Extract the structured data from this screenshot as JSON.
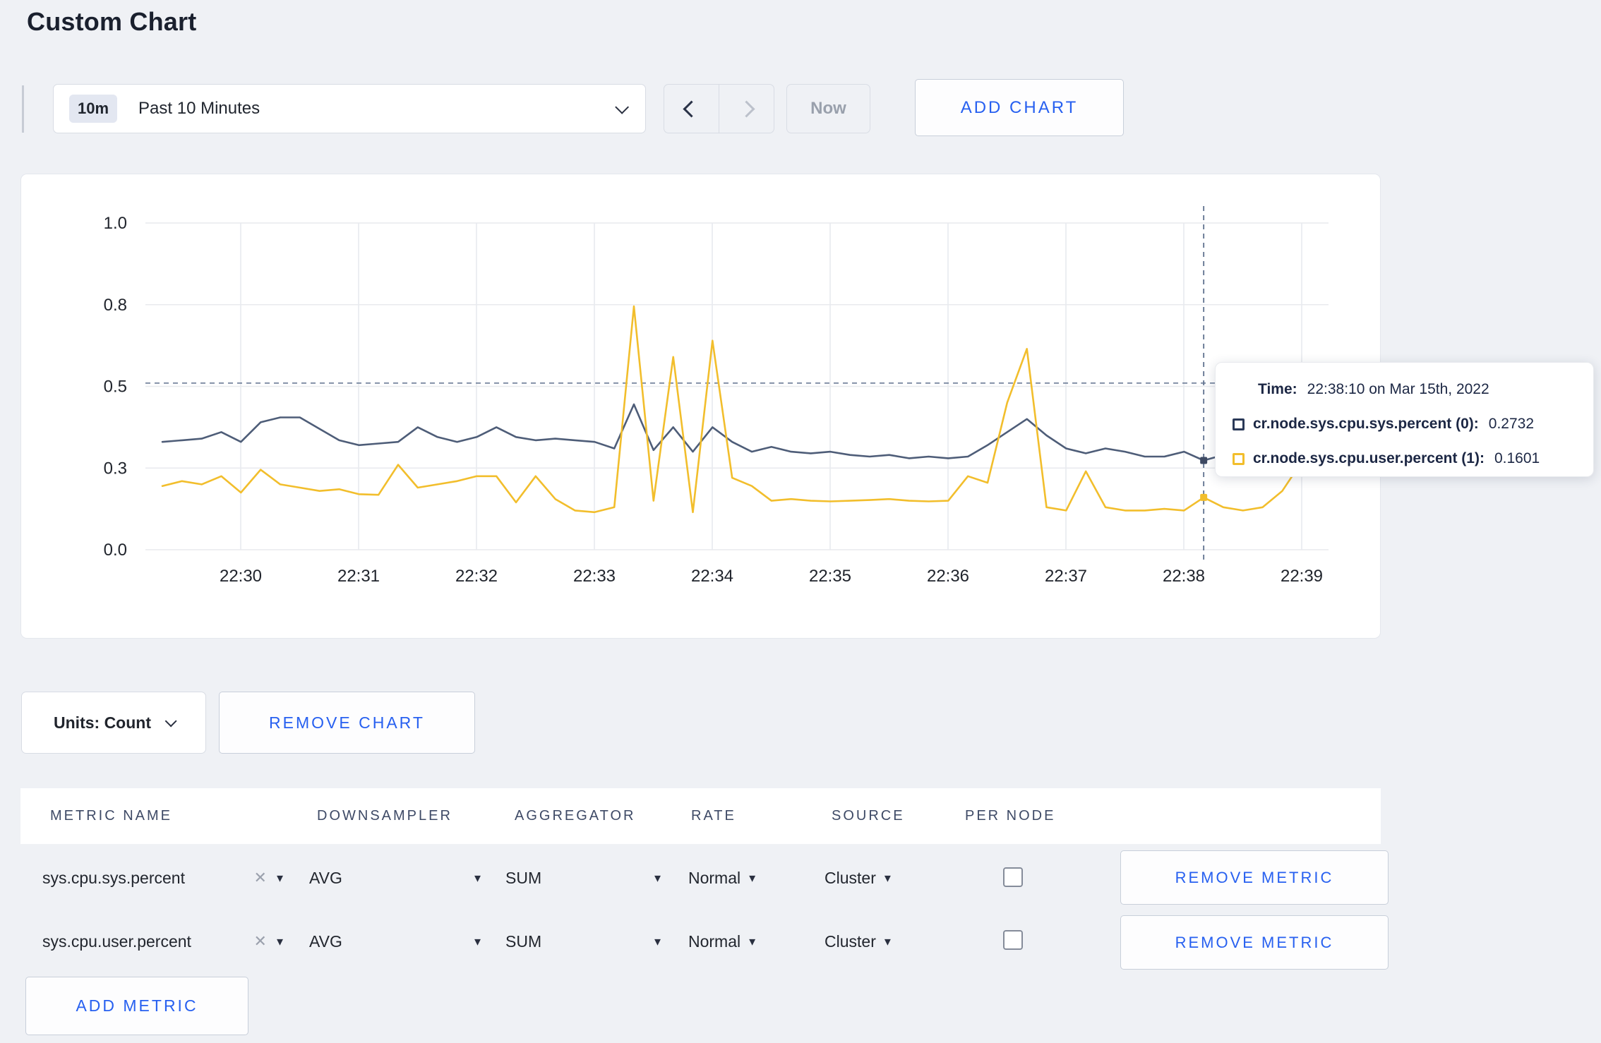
{
  "page": {
    "title": "Custom Chart"
  },
  "toolbar": {
    "range_badge": "10m",
    "range_label": "Past 10 Minutes",
    "now_label": "Now",
    "add_chart_label": "ADD CHART"
  },
  "icons": {
    "close_glyph": "✕",
    "caret_glyph": "▾"
  },
  "colors": {
    "accent_blue": "#2760f0",
    "series_sys": "#4e5d78",
    "series_user": "#f2be2c",
    "gridline": "#e8eaee",
    "crosshair": "#5f718e"
  },
  "tooltip": {
    "time_label": "Time:",
    "time_value": "22:38:10 on Mar 15th, 2022",
    "series": [
      {
        "label": "cr.node.sys.cpu.sys.percent (0):",
        "value": "0.2732",
        "color": "#2a3958"
      },
      {
        "label": "cr.node.sys.cpu.user.percent (1):",
        "value": "0.1601",
        "color": "#f2be2c"
      }
    ]
  },
  "chart_controls": {
    "units_label": "Units: Count",
    "remove_chart_label": "REMOVE CHART",
    "add_metric_label": "ADD METRIC"
  },
  "table": {
    "headers": [
      "METRIC NAME",
      "DOWNSAMPLER",
      "AGGREGATOR",
      "RATE",
      "SOURCE",
      "PER NODE"
    ],
    "rows": [
      {
        "metric": "sys.cpu.sys.percent",
        "downsampler": "AVG",
        "aggregator": "SUM",
        "rate": "Normal",
        "source": "Cluster",
        "per_node_checked": false,
        "remove_label": "REMOVE METRIC"
      },
      {
        "metric": "sys.cpu.user.percent",
        "downsampler": "AVG",
        "aggregator": "SUM",
        "rate": "Normal",
        "source": "Cluster",
        "per_node_checked": false,
        "remove_label": "REMOVE METRIC"
      }
    ]
  },
  "chart_data": {
    "type": "line",
    "title": "",
    "xlabel": "",
    "ylabel": "",
    "grid": true,
    "legend_position": "none",
    "ylim": [
      0,
      1.07
    ],
    "y_tick_values": [
      0,
      0.25,
      0.5,
      0.75,
      1.0
    ],
    "y_tick_labels": [
      "0.0",
      "0.3",
      "0.5",
      "0.8",
      "1.0"
    ],
    "x_ticks": [
      "22:30",
      "22:31",
      "22:32",
      "22:33",
      "22:34",
      "22:35",
      "22:36",
      "22:37",
      "22:38",
      "22:39"
    ],
    "x_start_time": "22:29:20",
    "x_interval_seconds": 10,
    "max_dashed_line_value": 0.51,
    "crosshair": {
      "time": "22:38:10",
      "point_index": 53,
      "highlighted_values": [
        0.2732,
        0.1601
      ]
    },
    "series": [
      {
        "name": "cr.node.sys.cpu.sys.percent",
        "color": "#4e5d78",
        "values": [
          0.33,
          0.335,
          0.34,
          0.36,
          0.33,
          0.39,
          0.405,
          0.405,
          0.37,
          0.335,
          0.32,
          0.325,
          0.33,
          0.375,
          0.345,
          0.33,
          0.345,
          0.375,
          0.345,
          0.335,
          0.34,
          0.335,
          0.33,
          0.31,
          0.445,
          0.305,
          0.375,
          0.3,
          0.375,
          0.33,
          0.3,
          0.315,
          0.3,
          0.295,
          0.3,
          0.29,
          0.285,
          0.29,
          0.28,
          0.285,
          0.28,
          0.285,
          0.32,
          0.36,
          0.4,
          0.35,
          0.31,
          0.295,
          0.31,
          0.3,
          0.285,
          0.285,
          0.3,
          0.2732,
          0.29,
          0.28,
          0.28,
          0.285,
          0.29,
          0.3
        ]
      },
      {
        "name": "cr.node.sys.cpu.user.percent",
        "color": "#f2be2c",
        "values": [
          0.195,
          0.21,
          0.2,
          0.225,
          0.175,
          0.245,
          0.2,
          0.19,
          0.18,
          0.185,
          0.17,
          0.168,
          0.26,
          0.19,
          0.2,
          0.21,
          0.225,
          0.225,
          0.145,
          0.225,
          0.155,
          0.12,
          0.115,
          0.13,
          0.745,
          0.15,
          0.59,
          0.115,
          0.64,
          0.22,
          0.195,
          0.15,
          0.155,
          0.15,
          0.148,
          0.15,
          0.152,
          0.155,
          0.15,
          0.148,
          0.15,
          0.225,
          0.205,
          0.45,
          0.615,
          0.13,
          0.12,
          0.24,
          0.13,
          0.12,
          0.12,
          0.125,
          0.12,
          0.1601,
          0.13,
          0.12,
          0.13,
          0.18,
          0.27,
          0.24
        ]
      }
    ]
  }
}
